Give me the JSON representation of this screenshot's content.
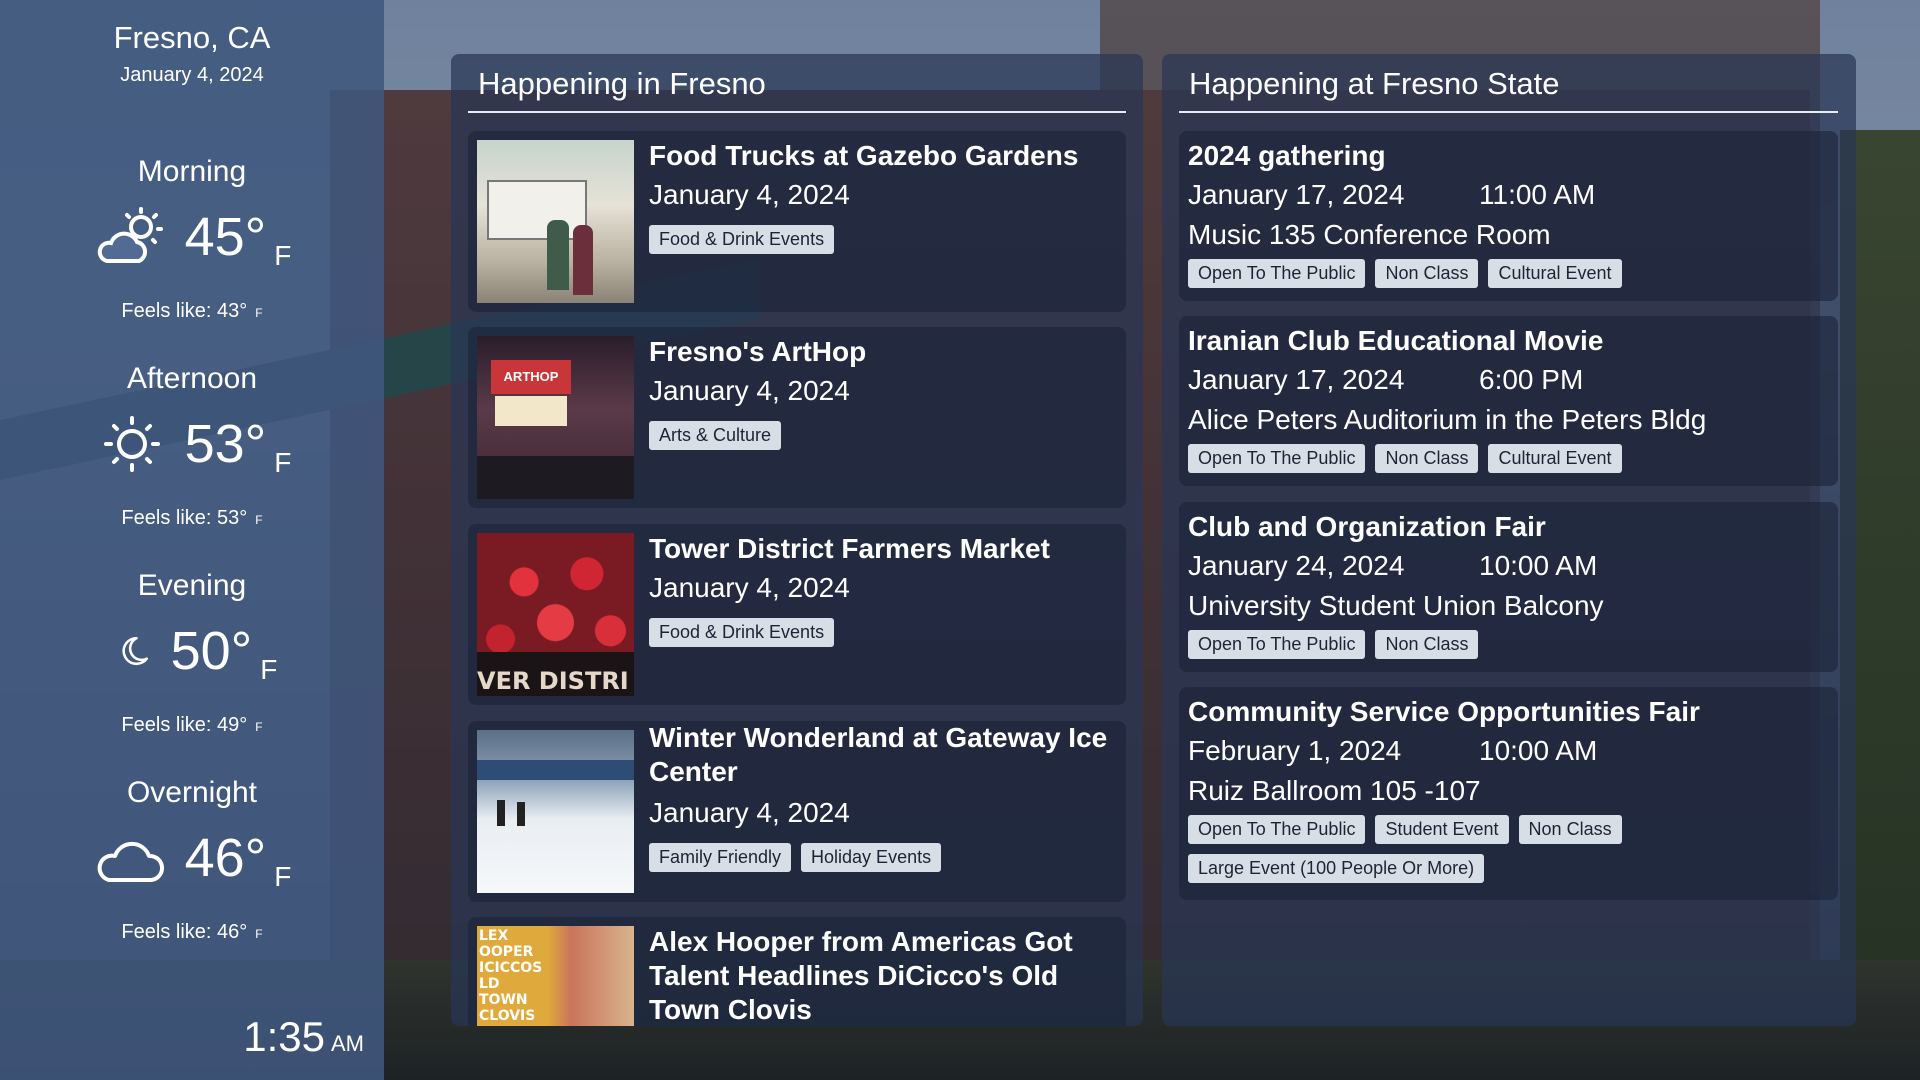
{
  "location": {
    "city": "Fresno, CA",
    "date": "January 4, 2024"
  },
  "weather": [
    {
      "period": "Morning",
      "temp": "45°",
      "unit": "F",
      "feels": "Feels like: 43°",
      "feels_unit": "F",
      "icon": "partly-cloudy-sun-icon"
    },
    {
      "period": "Afternoon",
      "temp": "53°",
      "unit": "F",
      "feels": "Feels like: 53°",
      "feels_unit": "F",
      "icon": "sun-icon"
    },
    {
      "period": "Evening",
      "temp": "50°",
      "unit": "F",
      "feels": "Feels like: 49°",
      "feels_unit": "F",
      "icon": "moon-icon"
    },
    {
      "period": "Overnight",
      "temp": "46°",
      "unit": "F",
      "feels": "Feels like: 46°",
      "feels_unit": "F",
      "icon": "cloud-icon"
    }
  ],
  "clock": {
    "time": "1:35",
    "ampm": "AM"
  },
  "fresno_events": {
    "title": "Happening in Fresno",
    "items": [
      {
        "title": "Food Trucks at Gazebo Gardens",
        "date": "January 4, 2024",
        "tags": [
          "Food & Drink Events"
        ]
      },
      {
        "title": "Fresno's ArtHop",
        "date": "January 4, 2024",
        "tags": [
          "Arts & Culture"
        ]
      },
      {
        "title": "Tower District Farmers Market",
        "date": "January 4, 2024",
        "tags": [
          "Food & Drink Events"
        ],
        "thumb_text": "VER DISTRI MERS MAR"
      },
      {
        "title": "Winter Wonderland at Gateway Ice Center",
        "date": "January 4, 2024",
        "tags": [
          "Family Friendly",
          "Holiday Events"
        ]
      },
      {
        "title": "Alex Hooper from Americas Got Talent Headlines DiCicco's Old Town Clovis",
        "date": "",
        "tags": [],
        "thumb_text": "LEX OOPER ICICCOS LD TOWN CLOVIS"
      }
    ]
  },
  "state_events": {
    "title": "Happening at Fresno State",
    "items": [
      {
        "title": "2024 gathering",
        "date": "January 17, 2024",
        "time": "11:00 AM",
        "location": "Music 135 Conference Room",
        "tags": [
          "Open To The Public",
          "Non Class",
          "Cultural Event"
        ]
      },
      {
        "title": "Iranian Club Educational Movie",
        "date": "January 17, 2024",
        "time": "6:00 PM",
        "location": "Alice Peters Auditorium in the Peters Bldg",
        "tags": [
          "Open To The Public",
          "Non Class",
          "Cultural Event"
        ]
      },
      {
        "title": "Club and Organization Fair",
        "date": "January 24, 2024",
        "time": "10:00 AM",
        "location": "University Student Union Balcony",
        "tags": [
          "Open To The Public",
          "Non Class"
        ]
      },
      {
        "title": "Community Service Opportunities Fair",
        "date": "February 1, 2024",
        "time": "10:00 AM",
        "location": "Ruiz Ballroom 105 -107",
        "tags": [
          "Open To The Public",
          "Student Event",
          "Non Class",
          "Large Event (100 People Or More)"
        ]
      }
    ]
  }
}
